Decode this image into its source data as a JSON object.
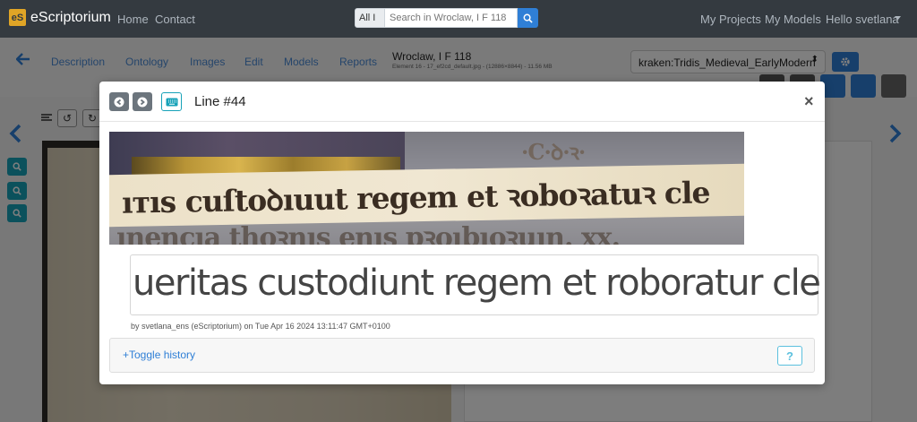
{
  "navbar": {
    "brand_logo": "eS",
    "brand": "eScriptorium",
    "links": [
      "Home",
      "Contact"
    ],
    "search_scope": "All I",
    "search_value": "Search in Wroclaw, I F 118",
    "right_links": [
      "My Projects",
      "My Models",
      "Hello svetlana"
    ]
  },
  "document": {
    "tabs": [
      "Description",
      "Ontology",
      "Images",
      "Edit",
      "Models",
      "Reports"
    ],
    "title": "Wroclaw, I F 118",
    "subtitle": "Element 16 - 17_ef2cd_default.jpg - (12886×8844) - 11.56 MB",
    "model_select": "kraken:Tridis_Medieval_EarlyModern"
  },
  "modal": {
    "title": "Line #44",
    "close": "×",
    "transcription": "ueritas custodiunt regem et roboratur cle",
    "byline": "by svetlana_ens (eScriptorium) on Tue Apr 16 2024 13:11:47 GMT+0100",
    "toggle_history": "+Toggle history",
    "help": "?"
  },
  "colors": {
    "navbar": "#343a40",
    "accent": "#2f7fd6",
    "info": "#17a2b8",
    "secondary": "#6c757d"
  },
  "icons": [
    "search-icon",
    "arrow-left-icon",
    "arrow-right-icon",
    "keyboard-icon",
    "gear-icon",
    "chevron-left-icon",
    "chevron-right-icon",
    "zoom-in-icon",
    "zoom-out-icon",
    "undo-icon",
    "redo-icon",
    "caret-down-icon"
  ]
}
